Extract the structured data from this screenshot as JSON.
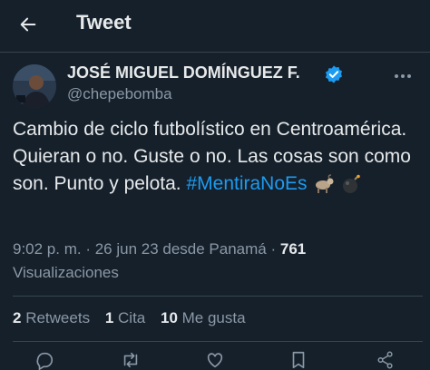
{
  "header": {
    "title": "Tweet"
  },
  "author": {
    "display_name": "JOSÉ MIGUEL DOMÍNGUEZ F.",
    "handle": "@chepebomba"
  },
  "tweet": {
    "text_before_hashtag": "Cambio de ciclo futbolístico en Centroamérica. Quieran o no. Guste o no. Las cosas son como son. Punto y pelota. ",
    "hashtag": "#MentiraNoEs",
    "emojis": [
      "goat-emoji",
      "bomb-emoji"
    ]
  },
  "meta": {
    "time": "9:02 p. m.",
    "separator": " · ",
    "date_place": "26 jun 23 desde Panamá",
    "views_count": "761",
    "views_label": "Visualizaciones"
  },
  "stats": {
    "retweets_count": "2",
    "retweets_label": "Retweets",
    "quotes_count": "1",
    "quotes_label": "Cita",
    "likes_count": "10",
    "likes_label": "Me gusta"
  },
  "colors": {
    "background": "#15202b",
    "text": "#e7e9ea",
    "muted": "#8b98a5",
    "accent": "#1d9bf0",
    "divider": "#38444d"
  }
}
